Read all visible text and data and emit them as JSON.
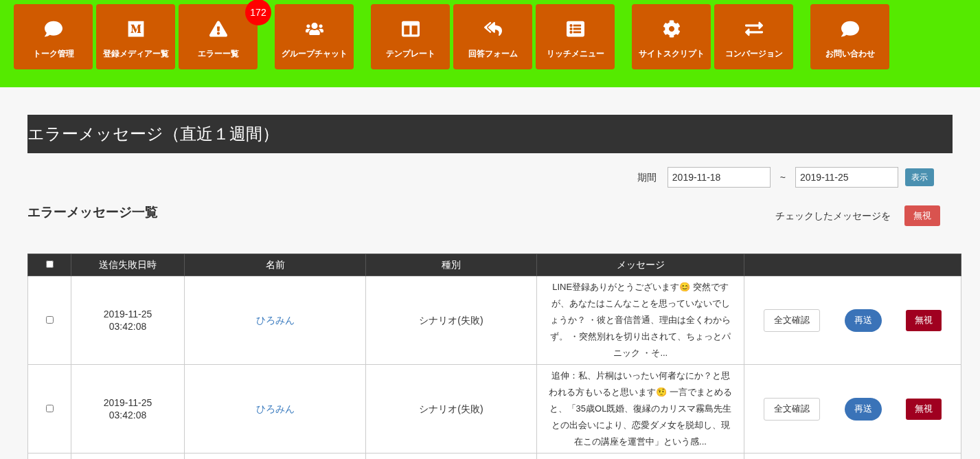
{
  "nav_groups": [
    {
      "tiles": [
        {
          "label": "トーク管理"
        },
        {
          "label": "登録メディアー覧"
        },
        {
          "label": "エラーー覧",
          "badge": "172"
        }
      ]
    },
    {
      "tiles": [
        {
          "label": "グループチャット"
        }
      ]
    },
    {
      "tiles": [
        {
          "label": "テンプレート"
        },
        {
          "label": "回答フォーム"
        },
        {
          "label": "リッチメニュー"
        }
      ]
    },
    {
      "tiles": [
        {
          "label": "サイトスクリプト"
        },
        {
          "label": "コンバージョン"
        }
      ]
    },
    {
      "tiles": [
        {
          "label": "お問い合わせ"
        }
      ]
    }
  ],
  "page_title": "エラーメッセージ（直近１週間）",
  "period": {
    "label": "期間",
    "from": "2019-11-18",
    "separator": "~",
    "to": "2019-11-25",
    "button": "表示"
  },
  "section_title": "エラーメッセージ一覧",
  "bulk": {
    "label": "チェックしたメッセージを",
    "button": "無視"
  },
  "table": {
    "header_checked": false,
    "columns": [
      "送信失敗日時",
      "名前",
      "種別",
      "メッセージ"
    ],
    "rows": [
      {
        "checked": false,
        "date": "2019-11-25",
        "time": "03:42:08",
        "name": "ひろみん",
        "kind": "シナリオ(失敗)",
        "message": "LINE登録ありがとうございます😊 突然ですが、あなたはこんなことを思っていないでしょうか？ ・彼と音信普通、理由は全くわからず。 ・突然別れを切り出されて、ちょっとパニック ・そ...",
        "full_button": "全文確認",
        "resend_button": "再送",
        "ignore_button": "無視"
      },
      {
        "checked": false,
        "date": "2019-11-25",
        "time": "03:42:08",
        "name": "ひろみん",
        "kind": "シナリオ(失敗)",
        "message": "追伸：私、片桐はいったい何者なにか？と思われる方もいると思います🤨 一言でまとめると、「35歳OL既婚、復縁のカリスマ霧島先生との出会いにより、恋愛ダメ女を脱却し、現在この講座を運営中」という感...",
        "full_button": "全文確認",
        "resend_button": "再送",
        "ignore_button": "無視"
      }
    ]
  }
}
